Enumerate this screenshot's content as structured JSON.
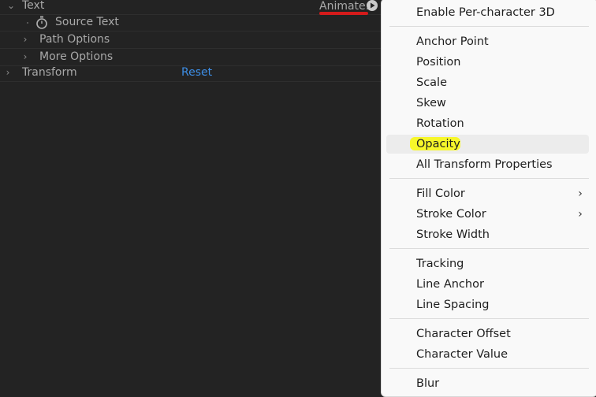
{
  "panel": {
    "rows": {
      "text": {
        "label": "Text"
      },
      "source_text": {
        "label": "Source Text"
      },
      "path_options": {
        "label": "Path Options"
      },
      "more_options": {
        "label": "More Options"
      },
      "transform": {
        "label": "Transform",
        "reset": "Reset"
      }
    },
    "animate": {
      "label": "Animate:"
    }
  },
  "menu": {
    "items": [
      {
        "label": "Enable Per-character 3D"
      },
      {
        "label": "Anchor Point"
      },
      {
        "label": "Position"
      },
      {
        "label": "Scale"
      },
      {
        "label": "Skew"
      },
      {
        "label": "Rotation"
      },
      {
        "label": "Opacity",
        "highlighted": true
      },
      {
        "label": "All Transform Properties"
      },
      {
        "label": "Fill Color",
        "submenu": true
      },
      {
        "label": "Stroke Color",
        "submenu": true
      },
      {
        "label": "Stroke Width"
      },
      {
        "label": "Tracking"
      },
      {
        "label": "Line Anchor"
      },
      {
        "label": "Line Spacing"
      },
      {
        "label": "Character Offset"
      },
      {
        "label": "Character Value"
      },
      {
        "label": "Blur"
      }
    ]
  },
  "colors": {
    "panel_bg": "#232323",
    "menu_bg": "#f9f9f9",
    "link": "#3d8ee6",
    "underline_annotation": "#d41b1b",
    "highlight_annotation": "#f7f72a"
  }
}
